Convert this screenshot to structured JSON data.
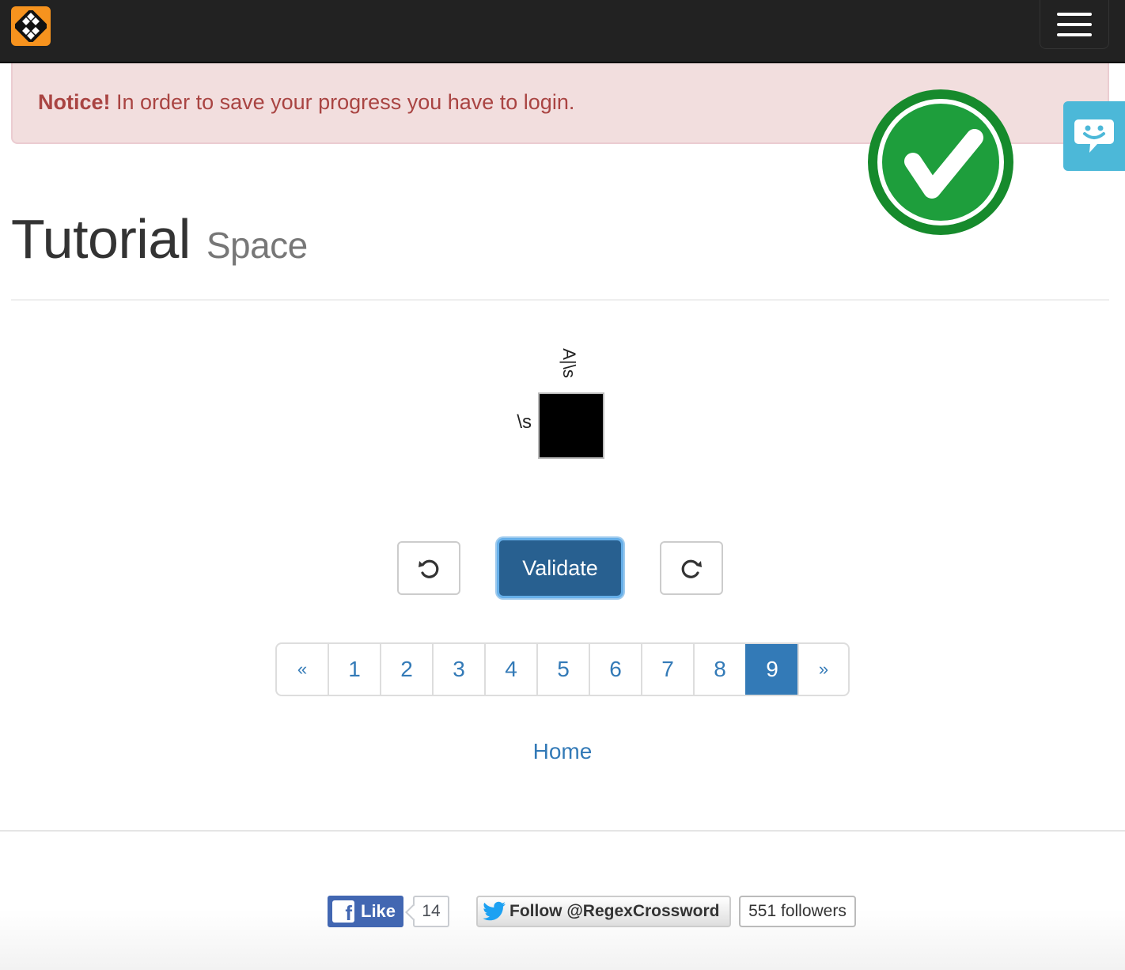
{
  "colors": {
    "navbar": "#222222",
    "logo_bg": "#f7931e",
    "alert_bg": "#f2dede",
    "alert_text": "#a94442",
    "primary": "#337ab7",
    "validate_bg": "#286090",
    "check_green": "#1e9e3c",
    "chat_tab": "#4cb8d8",
    "facebook": "#4267b2",
    "twitter": "#1da1f2"
  },
  "navbar": {
    "logo_icon": "regex-crossword-logo-icon",
    "menu_icon": "hamburger-menu-icon"
  },
  "alert": {
    "strong": "Notice!",
    "message": " In order to save your progress you have to login."
  },
  "status": {
    "icon": "check-circle-icon",
    "state": "solved"
  },
  "chat": {
    "icon": "chat-smile-icon"
  },
  "heading": {
    "title": "Tutorial",
    "subtitle": "Space"
  },
  "puzzle": {
    "column_clues": [
      "A|\\s"
    ],
    "row_clues": [
      "\\s"
    ],
    "cells": [
      " "
    ]
  },
  "controls": {
    "undo_icon": "undo-icon",
    "validate_label": "Validate",
    "redo_icon": "redo-icon"
  },
  "pagination": {
    "prev": "«",
    "pages": [
      "1",
      "2",
      "3",
      "4",
      "5",
      "6",
      "7",
      "8",
      "9"
    ],
    "active": "9",
    "next": "»"
  },
  "home_link": "Home",
  "social": {
    "facebook": {
      "icon": "facebook-icon",
      "label": "Like",
      "count": "14"
    },
    "twitter": {
      "icon": "twitter-bird-icon",
      "label": "Follow @RegexCrossword",
      "count": "551 followers"
    }
  }
}
